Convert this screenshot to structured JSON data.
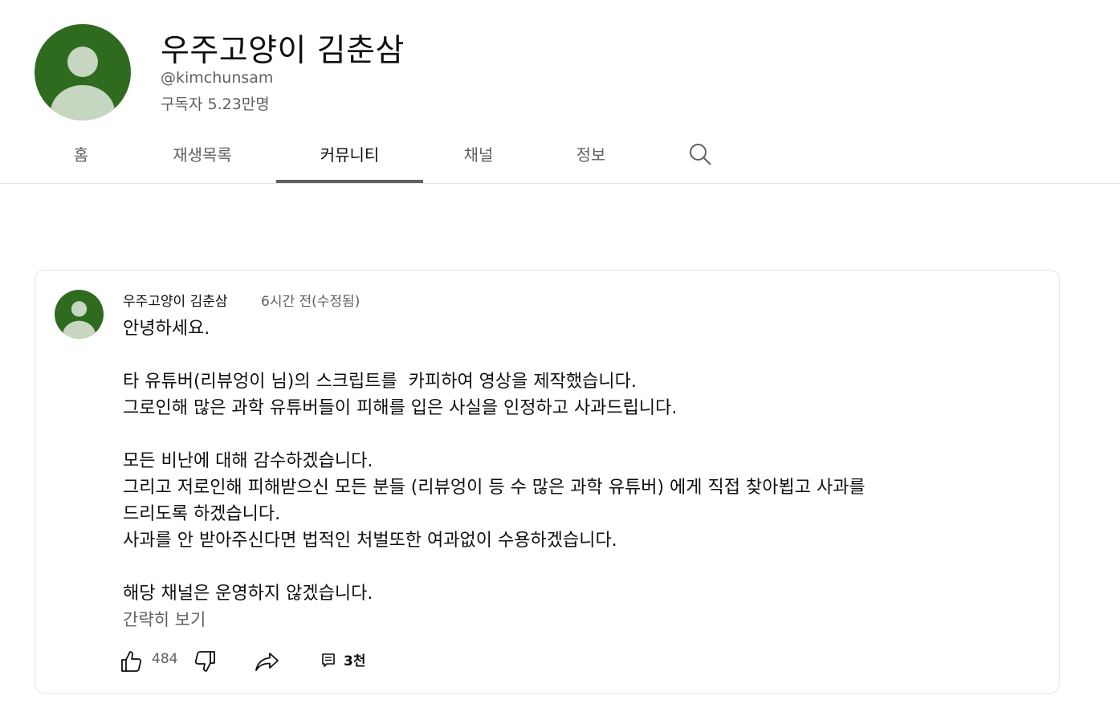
{
  "channel": {
    "name": "우주고양이 김춘삼",
    "handle": "@kimchunsam",
    "subscribers": "구독자 5.23만명",
    "avatar_color": "#2e6b1f"
  },
  "tabs": [
    {
      "label": "홈"
    },
    {
      "label": "재생목록"
    },
    {
      "label": "커뮤니티"
    },
    {
      "label": "채널"
    },
    {
      "label": "정보"
    }
  ],
  "active_tab": "커뮤니티",
  "post": {
    "author": "우주고양이 김춘삼",
    "time": "6시간 전(수정됨)",
    "lines": [
      "안녕하세요.",
      "",
      "타 유튜버(리뷰엉이 님)의 스크립트를  카피하여 영상을 제작했습니다.",
      "그로인해 많은 과학 유튜버들이 피해를 입은 사실을 인정하고 사과드립니다.",
      "",
      "모든 비난에 대해 감수하겠습니다.",
      "그리고 저로인해 피해받으신 모든 분들 (리뷰엉이 등 수 많은 과학 유튜버) 에게 직접 찾아뵙고 사과를",
      "드리도록 하겠습니다.",
      "사과를 안 받아주신다면 법적인 처벌또한 여과없이 수용하겠습니다.",
      "",
      "해당 채널은 운영하지 않겠습니다."
    ],
    "show_less": "간략히 보기",
    "likes": "484",
    "comments": "3천"
  },
  "icons": {
    "search": "search-icon",
    "like": "thumbs-up-icon",
    "dislike": "thumbs-down-icon",
    "share": "share-icon",
    "comment": "comment-icon"
  }
}
